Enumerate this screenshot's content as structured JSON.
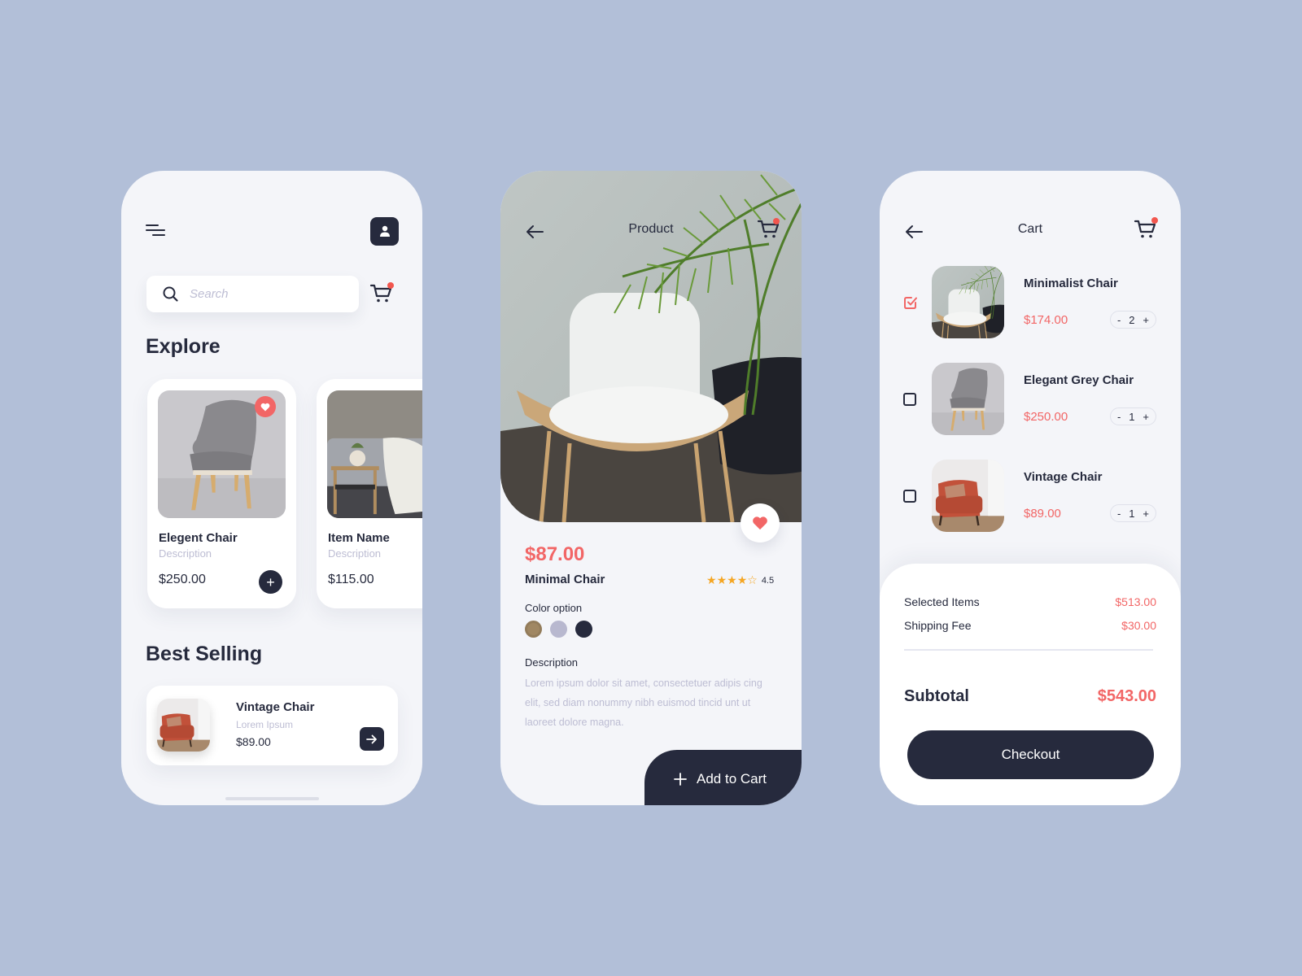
{
  "colors": {
    "background": "#b2bfd8",
    "screen": "#f4f5f9",
    "dark": "#262a3d",
    "accent": "#f26666",
    "muted": "#bdbdd3",
    "star": "#f5a623"
  },
  "explore_screen": {
    "search": {
      "placeholder": "Search",
      "value": ""
    },
    "explore_title": "Explore",
    "products": [
      {
        "name": "Elegent Chair",
        "description": "Description",
        "price": "$250.00",
        "favorite": true,
        "image": "grey-chair-photo"
      },
      {
        "name": "Item Name",
        "description": "Description",
        "price": "$115.00",
        "image": "living-room-photo"
      }
    ],
    "best_selling_title": "Best Selling",
    "best_selling": {
      "name": "Vintage Chair",
      "description": "Lorem Ipsum",
      "price": "$89.00",
      "image": "orange-armchair-photo"
    }
  },
  "product_screen": {
    "title": "Product",
    "price": "$87.00",
    "name": "Minimal Chair",
    "rating": 4.5,
    "rating_label": "4.5",
    "stars_filled": 4,
    "stars_total": 5,
    "color_option_label": "Color option",
    "color_options": [
      "#a08763",
      "#b8b8cf",
      "#262a3d"
    ],
    "description_label": "Description",
    "description": "Lorem ipsum dolor sit amet, consectetuer adipis cing elit, sed diam nonummy nibh euismod tincid unt ut laoreet dolore magna.",
    "add_to_cart_label": "Add to Cart",
    "image": "white-chair-with-palm-photo"
  },
  "cart_screen": {
    "title": "Cart",
    "items": [
      {
        "name": "Minimalist Chair",
        "price": "$174.00",
        "quantity": "2",
        "checked": true,
        "image": "white-chair-photo"
      },
      {
        "name": "Elegant Grey Chair",
        "price": "$250.00",
        "quantity": "1",
        "checked": false,
        "image": "grey-chair-photo"
      },
      {
        "name": "Vintage Chair",
        "price": "$89.00",
        "quantity": "1",
        "checked": false,
        "image": "orange-armchair-photo"
      }
    ],
    "qty_minus": "-",
    "qty_plus": "+",
    "summary": {
      "selected_items_label": "Selected Items",
      "selected_items_value": "$513.00",
      "shipping_fee_label": "Shipping Fee",
      "shipping_fee_value": "$30.00",
      "subtotal_label": "Subtotal",
      "subtotal_value": "$543.00"
    },
    "checkout_label": "Checkout"
  }
}
